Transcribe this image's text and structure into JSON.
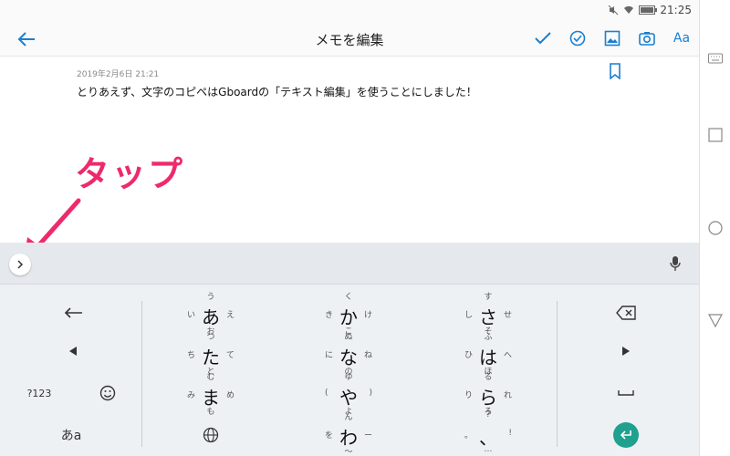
{
  "status": {
    "time": "21:25"
  },
  "appbar": {
    "title": "メモを編集",
    "font_label": "Aa"
  },
  "memo": {
    "date": "2019年2月6日 21:21",
    "text": "とりあえず、文字のコピペはGboardの「テキスト編集」を使うことにしました！",
    "annotation": "タップ"
  },
  "keyboard": {
    "num_label": "?123",
    "mode_label": "あa",
    "keys": [
      {
        "main": "あ",
        "left": "い",
        "up": "う",
        "right": "え",
        "down": "お"
      },
      {
        "main": "か",
        "left": "き",
        "up": "く",
        "right": "け",
        "down": "こ"
      },
      {
        "main": "さ",
        "left": "し",
        "up": "す",
        "right": "せ",
        "down": "そ"
      },
      {
        "main": "た",
        "left": "ち",
        "up": "つ",
        "right": "て",
        "down": "と"
      },
      {
        "main": "な",
        "left": "に",
        "up": "ぬ",
        "right": "ね",
        "down": "の"
      },
      {
        "main": "は",
        "left": "ひ",
        "up": "ふ",
        "right": "へ",
        "down": "ほ"
      },
      {
        "main": "ま",
        "left": "み",
        "up": "む",
        "right": "め",
        "down": "も"
      },
      {
        "main": "や",
        "left": "(",
        "up": "ゆ",
        "right": ")",
        "down": "よ"
      },
      {
        "main": "ら",
        "left": "り",
        "up": "る",
        "right": "れ",
        "down": "ろ"
      },
      {
        "main": "わ",
        "left": "を",
        "up": "ん",
        "right": "ー",
        "down": "〜"
      },
      {
        "main": "、",
        "left": "。",
        "up": "?",
        "right": "!",
        "down": "…"
      }
    ]
  },
  "colors": {
    "accent": "#1a7fd0",
    "annotation": "#ee2a6b",
    "enter": "#20a08e",
    "keyboard_bg": "#eef1f4"
  }
}
